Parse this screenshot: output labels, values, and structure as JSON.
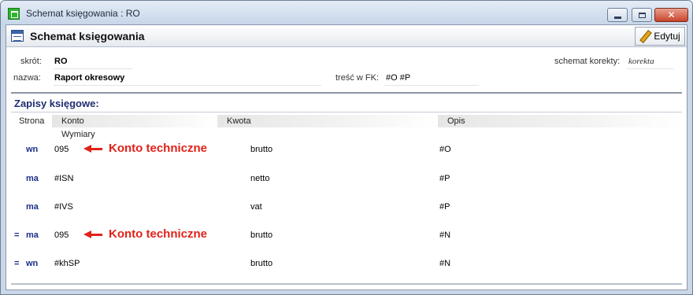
{
  "window": {
    "title": "Schemat księgowania : RO",
    "minimize_label": "",
    "maximize_label": "",
    "close_label": "✕"
  },
  "header": {
    "title": "Schemat księgowania",
    "edit_label": "Edytuj"
  },
  "info": {
    "skrot_label": "skrót:",
    "skrot_value": "RO",
    "nazwa_label": "nazwa:",
    "nazwa_value": "Raport okresowy",
    "tresc_label": "treść w FK:",
    "tresc_value": "#O #P",
    "korekta_label": "schemat korekty:",
    "korekta_value": "korekta"
  },
  "section": {
    "title": "Zapisy księgowe:"
  },
  "columns": {
    "strona": "Strona",
    "konto": "Konto",
    "kwota": "Kwota",
    "opis": "Opis",
    "wymiary": "Wymiary"
  },
  "rows": [
    {
      "prefix": "",
      "strona": "wn",
      "konto": "095",
      "kwota": "brutto",
      "opis": "#O",
      "annotation": "Konto techniczne"
    },
    {
      "prefix": "",
      "strona": "ma",
      "konto": "#ISN",
      "kwota": "netto",
      "opis": "#P",
      "annotation": ""
    },
    {
      "prefix": "",
      "strona": "ma",
      "konto": "#IVS",
      "kwota": "vat",
      "opis": "#P",
      "annotation": ""
    },
    {
      "prefix": "=",
      "strona": "ma",
      "konto": "095",
      "kwota": "brutto",
      "opis": "#N",
      "annotation": "Konto techniczne"
    },
    {
      "prefix": "=",
      "strona": "wn",
      "konto": "#khSP",
      "kwota": "brutto",
      "opis": "#N",
      "annotation": ""
    }
  ],
  "icons": {
    "app": "app-icon",
    "header": "schema-icon",
    "edit": "pencil-icon",
    "arrow": "arrow-left-icon"
  },
  "colors": {
    "side_text": "#1a2e8a",
    "annotation": "#e0221a",
    "section_title": "#1f2e70"
  }
}
